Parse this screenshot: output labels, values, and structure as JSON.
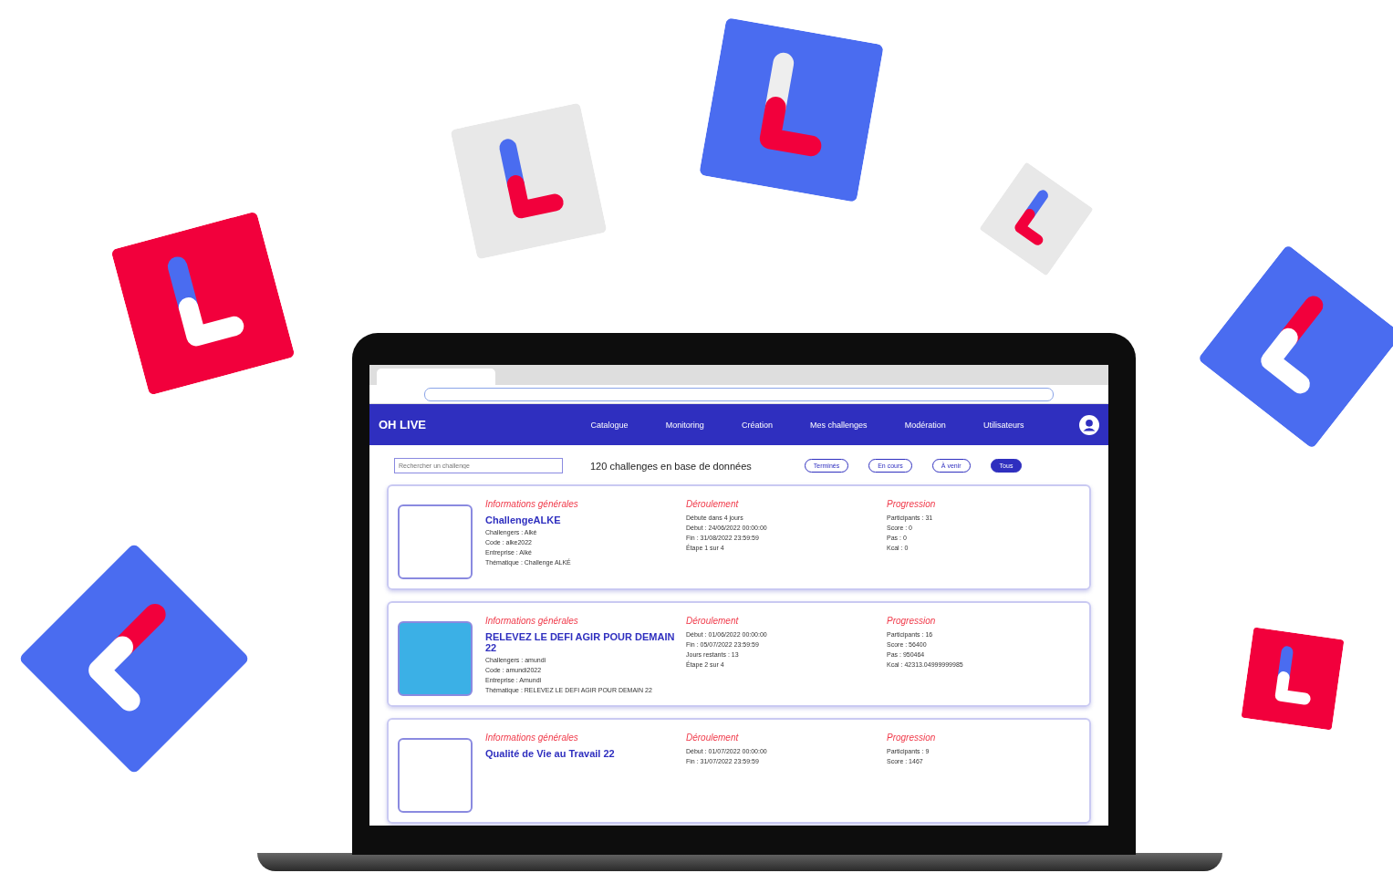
{
  "app": {
    "logo": "OH LIVE",
    "nav": [
      {
        "label": "Catalogue"
      },
      {
        "label": "Monitoring"
      },
      {
        "label": "Création"
      },
      {
        "label": "Mes challenges"
      },
      {
        "label": "Modération"
      },
      {
        "label": "Utilisateurs"
      }
    ]
  },
  "search": {
    "placeholder": "Rechercher un challenge"
  },
  "count": "120 challenges en base de données",
  "filters": [
    {
      "label": "Terminés",
      "selected": false
    },
    {
      "label": "En cours",
      "selected": false
    },
    {
      "label": "À venir",
      "selected": false
    },
    {
      "label": "Tous",
      "selected": true
    }
  ],
  "cards": [
    {
      "kind": "logo",
      "sections": [
        {
          "heading": "Informations générales",
          "title": "ChallengeALKE",
          "lines": [
            "Challengers : Alké",
            "Code : alke2022",
            "Entreprise : Alké",
            "Thématique : Challenge ALKÉ"
          ]
        },
        {
          "heading": "Déroulement",
          "lines": [
            "Débute dans 4 jours",
            "Début : 24/06/2022 00:00:00",
            "Fin : 31/08/2022 23:59:59",
            "Étape 1 sur 4"
          ]
        },
        {
          "heading": "Progression",
          "lines": [
            "Participants : 31",
            "Score : 0",
            "Pas : 0",
            "Kcal : 0"
          ]
        }
      ]
    },
    {
      "kind": "banner",
      "sections": [
        {
          "heading": "Informations générales",
          "title": "RELEVEZ LE DEFI AGIR POUR DEMAIN 22",
          "lines": [
            "Challengers : amundi",
            "Code : amundi2022",
            "Entreprise : Amundi",
            "Thématique : RELEVEZ LE DEFI AGIR POUR DEMAIN 22"
          ]
        },
        {
          "heading": "Déroulement",
          "lines": [
            "Début : 01/06/2022 00:00:00",
            "Fin : 05/07/2022 23:59:59",
            "Jours restants : 13",
            "Étape 2 sur 4"
          ]
        },
        {
          "heading": "Progression",
          "lines": [
            "Participants : 16",
            "Score : 56400",
            "Pas : 950464",
            "Kcal : 42313.04999999985"
          ]
        }
      ]
    },
    {
      "kind": "logo",
      "sections": [
        {
          "heading": "Informations générales",
          "title": "Qualité de Vie au Travail 22"
        },
        {
          "heading": "Déroulement",
          "lines": [
            "Début : 01/07/2022 00:00:00",
            "Fin : 31/07/2022 23:59:59"
          ]
        },
        {
          "heading": "Progression",
          "lines": [
            "Participants : 9",
            "Score : 1467"
          ]
        }
      ]
    }
  ]
}
